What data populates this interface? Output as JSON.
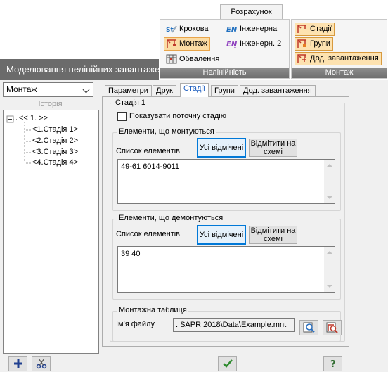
{
  "ribbon": {
    "tab_label": "Розрахунок",
    "groups": [
      {
        "caption": "Нелінійність",
        "buttons": [
          {
            "label": "Крокова",
            "icon": "step-icon"
          },
          {
            "label": "Інженерна",
            "icon": "engineering-icon"
          },
          {
            "label": "Монтаж",
            "icon": "crane-icon",
            "active": true
          },
          {
            "label": "Інженерн. 2",
            "icon": "engineering2-icon"
          },
          {
            "label": "Обвалення",
            "icon": "collapse-icon"
          }
        ]
      },
      {
        "caption": "Монтаж",
        "buttons": [
          {
            "label": "Стадії",
            "icon": "stages-icon",
            "active": true
          },
          {
            "label": "Групи",
            "icon": "groups-icon",
            "active": true
          },
          {
            "label": "Дод. завантаження",
            "icon": "additional-load-icon",
            "active": true
          }
        ]
      }
    ]
  },
  "window": {
    "title": "Моделювання нелінійних завантажень"
  },
  "left": {
    "mode_select": "Монтаж",
    "history_label": "Історія",
    "tree": {
      "root": "<< 1. >>",
      "children": [
        "<1.Стадія 1>",
        "<2.Стадія 2>",
        "<3.Стадія 3>",
        "<4.Стадія 4>"
      ]
    }
  },
  "tabs": [
    "Параметри",
    "Друк",
    "Стадії",
    "Групи",
    "Дод. завантаження"
  ],
  "active_tab": "Стадії",
  "stage": {
    "title": "Стадія 1",
    "show_current_label": "Показувати поточну стадію",
    "mounted": {
      "title": "Елементи, що монтуються",
      "list_label": "Список елементів",
      "all_selected_label": "Усі відмічені",
      "mark_on_scheme_label": "Відмітити на схемі",
      "list_value": "49-61 6014-9011"
    },
    "dismantled": {
      "title": "Елементи, що демонтуються",
      "list_label": "Список елементів",
      "all_selected_label": "Усі відмічені",
      "mark_on_scheme_label": "Відмітити на схемі",
      "list_value": "39 40"
    },
    "assembly_table": {
      "title": "Монтажна таблиця",
      "file_label": "Ім'я файлу",
      "file_value": ". SAPR 2018\\Data\\Example.mnt"
    }
  },
  "colors": {
    "accent": "#0078d7",
    "titlebar": "#6b6b6b",
    "ribbon_caption": "#7a7a7a",
    "active_button": "#fbdca4",
    "ok_green": "#2e8b2e",
    "add_blue": "#1f3f8f"
  }
}
